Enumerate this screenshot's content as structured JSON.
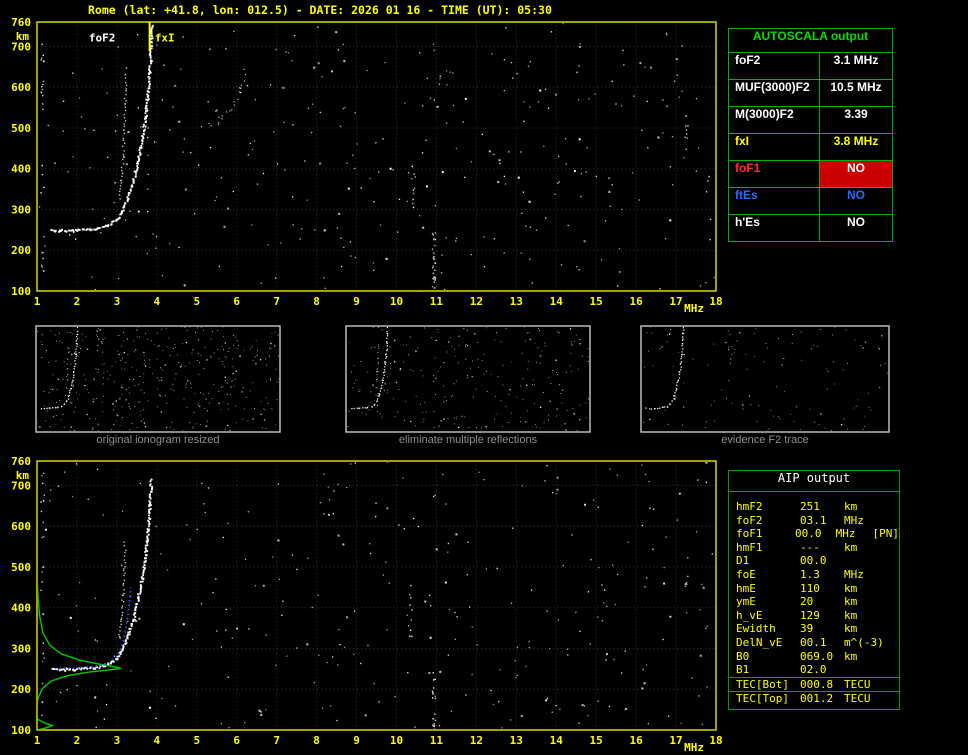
{
  "title": "Rome (lat: +41.8, lon: 012.5) - DATE: 2026 01 16 - TIME (UT): 05:30",
  "colors": {
    "axis": "#ffff00",
    "plot_border": "#e6e600",
    "table_green": "#00b400",
    "profile_green": "#00cc00",
    "fit_blue": "#3a5bff",
    "alert_red": "#cc0000",
    "es_blue": "#1e6eff",
    "caption_gray": "#8f8f8f"
  },
  "ionogram_top": {
    "y_unit": "km",
    "x_unit": "MHz",
    "y_ticks": [
      760,
      700,
      600,
      500,
      400,
      300,
      200,
      100
    ],
    "x_ticks": [
      1,
      2,
      3,
      4,
      5,
      6,
      7,
      8,
      9,
      10,
      11,
      12,
      13,
      14,
      15,
      16,
      17,
      18
    ],
    "f_range": [
      1,
      18
    ],
    "km_range": [
      100,
      760
    ],
    "annotations": [
      {
        "text": "foF2",
        "f": 2.3,
        "km": 712,
        "color": "#ffffff"
      },
      {
        "text": "fxI",
        "f": 3.95,
        "km": 712,
        "color": "#ffff00"
      }
    ],
    "marker_line": {
      "f": 3.82,
      "km_from": 688,
      "km_to": 760,
      "color": "#ffff00"
    },
    "traces": [
      {
        "points": [
          [
            1.35,
            250
          ],
          [
            1.9,
            250
          ],
          [
            2.45,
            255
          ],
          [
            2.75,
            262
          ],
          [
            2.95,
            274
          ],
          [
            3.1,
            295
          ],
          [
            3.25,
            330
          ],
          [
            3.4,
            375
          ],
          [
            3.52,
            425
          ],
          [
            3.62,
            475
          ],
          [
            3.7,
            530
          ],
          [
            3.76,
            590
          ],
          [
            3.81,
            655
          ],
          [
            3.84,
            715
          ],
          [
            3.86,
            752
          ]
        ],
        "size": 1.9,
        "step": 1.5,
        "jitter": 1.1,
        "color": "#ffffff"
      },
      {
        "points": [
          [
            3.05,
            330
          ],
          [
            3.1,
            375
          ],
          [
            3.14,
            430
          ],
          [
            3.17,
            495
          ],
          [
            3.19,
            560
          ],
          [
            3.21,
            630
          ]
        ],
        "size": 1.3,
        "step": 3,
        "jitter": 1,
        "color": "#d8d8d8"
      },
      {
        "points": [
          [
            5.15,
            505
          ],
          [
            5.5,
            515
          ],
          [
            5.85,
            545
          ],
          [
            6.1,
            595
          ],
          [
            6.2,
            645
          ]
        ],
        "size": 1.2,
        "step": 4.5,
        "jitter": 2.2,
        "color": "#c8c8c8"
      }
    ],
    "noise": {
      "count": 340,
      "seed": 20260116
    },
    "streaks": [
      {
        "f": 10.92,
        "km": [
          100,
          245
        ],
        "n": 26
      },
      {
        "f": 10.4,
        "km": [
          300,
          430
        ],
        "n": 10
      },
      {
        "f": 17.25,
        "km": [
          420,
          570
        ],
        "n": 8
      },
      {
        "f": 1.12,
        "km": [
          130,
          740
        ],
        "n": 24
      }
    ]
  },
  "ionogram_bottom": {
    "y_unit": "km",
    "x_unit": "MHz",
    "y_ticks": [
      760,
      700,
      600,
      500,
      400,
      300,
      200,
      100
    ],
    "x_ticks": [
      1,
      2,
      3,
      4,
      5,
      6,
      7,
      8,
      9,
      10,
      11,
      12,
      13,
      14,
      15,
      16,
      17,
      18
    ],
    "f_range": [
      1,
      18
    ],
    "km_range": [
      100,
      760
    ],
    "annotations": [],
    "traces": [
      {
        "points": [
          [
            1.35,
            250
          ],
          [
            1.9,
            250
          ],
          [
            2.45,
            255
          ],
          [
            2.75,
            262
          ],
          [
            2.95,
            274
          ],
          [
            3.1,
            295
          ],
          [
            3.25,
            330
          ],
          [
            3.4,
            375
          ],
          [
            3.52,
            425
          ],
          [
            3.62,
            475
          ],
          [
            3.7,
            530
          ],
          [
            3.76,
            590
          ],
          [
            3.81,
            655
          ],
          [
            3.84,
            715
          ]
        ],
        "size": 1.9,
        "step": 1.5,
        "jitter": 1.1,
        "color": "#ffffff"
      },
      {
        "points": [
          [
            3.05,
            330
          ],
          [
            3.1,
            375
          ],
          [
            3.14,
            430
          ],
          [
            3.17,
            495
          ],
          [
            3.19,
            560
          ]
        ],
        "size": 1.3,
        "step": 3,
        "jitter": 1,
        "color": "#d8d8d8"
      }
    ],
    "profile": {
      "color": "#00cc00",
      "points": [
        [
          1.02,
          100
        ],
        [
          1.3,
          107
        ],
        [
          1.38,
          111
        ],
        [
          1.2,
          117
        ],
        [
          1.02,
          126
        ],
        [
          0.97,
          140
        ],
        [
          0.98,
          158
        ],
        [
          1.03,
          178
        ],
        [
          1.12,
          200
        ],
        [
          1.35,
          220
        ],
        [
          1.75,
          233
        ],
        [
          2.3,
          242
        ],
        [
          2.85,
          248
        ],
        [
          3.1,
          251
        ],
        [
          2.95,
          255
        ],
        [
          2.55,
          262
        ],
        [
          2.05,
          272
        ],
        [
          1.6,
          287
        ],
        [
          1.32,
          308
        ],
        [
          1.15,
          338
        ],
        [
          1.07,
          378
        ],
        [
          1.03,
          420
        ],
        [
          1.01,
          455
        ]
      ]
    },
    "fit": {
      "color": "#3a5bff",
      "points": [
        [
          1.45,
          251
        ],
        [
          2.0,
          252
        ],
        [
          2.5,
          257
        ],
        [
          2.8,
          265
        ],
        [
          3.0,
          280
        ],
        [
          3.12,
          305
        ],
        [
          3.22,
          345
        ],
        [
          3.3,
          400
        ],
        [
          3.35,
          450
        ]
      ]
    },
    "noise": {
      "count": 300,
      "seed": 530
    },
    "streaks": [
      {
        "f": 10.92,
        "km": [
          100,
          255
        ],
        "n": 22
      },
      {
        "f": 10.35,
        "km": [
          330,
          470
        ],
        "n": 10
      },
      {
        "f": 1.12,
        "km": [
          140,
          740
        ],
        "n": 20
      },
      {
        "f": 17.25,
        "km": [
          430,
          560
        ],
        "n": 6
      }
    ]
  },
  "thumbnails": [
    {
      "caption": "original ionogram resized",
      "noise": {
        "count": 420,
        "seed": 5
      }
    },
    {
      "caption": "eliminate multiple reflections",
      "noise": {
        "count": 260,
        "seed": 9
      }
    },
    {
      "caption": "evidence F2 trace",
      "noise": {
        "count": 130,
        "seed": 13
      }
    }
  ],
  "autoscala": {
    "title": "AUTOSCALA output",
    "rows": [
      {
        "label": "foF2",
        "value": "3.1 MHz",
        "label_color": "#ffffff",
        "value_color": "#ffffff",
        "value_bg": ""
      },
      {
        "label": "MUF(3000)F2",
        "value": "10.5 MHz",
        "label_color": "#ffffff",
        "value_color": "#ffffff",
        "value_bg": ""
      },
      {
        "label": "M(3000)F2",
        "value": "3.39",
        "label_color": "#ffffff",
        "value_color": "#ffffff",
        "value_bg": ""
      },
      {
        "label": "fxI",
        "value": "3.8 MHz",
        "label_color": "#ffff00",
        "value_color": "#ffff00",
        "value_bg": ""
      },
      {
        "label": "foF1",
        "value": "NO",
        "label_color": "#ff3030",
        "value_color": "#ffffff",
        "value_bg": "#cc0000"
      },
      {
        "label": "ftEs",
        "value": "NO",
        "label_color": "#1e6eff",
        "value_color": "#1e6eff",
        "value_bg": ""
      },
      {
        "label": "h'Es",
        "value": "NO",
        "label_color": "#ffffff",
        "value_color": "#ffffff",
        "value_bg": ""
      }
    ]
  },
  "aip": {
    "title": "AIP output",
    "rows": [
      {
        "name": "hmF2",
        "value": "251",
        "unit": "km",
        "extra": "",
        "sep": false
      },
      {
        "name": "foF2",
        "value": "03.1",
        "unit": "MHz",
        "extra": "",
        "sep": false
      },
      {
        "name": "foF1",
        "value": "00.0",
        "unit": "MHz",
        "extra": "[PN]",
        "sep": false
      },
      {
        "name": "hmF1",
        "value": "---",
        "unit": "km",
        "extra": "",
        "sep": false
      },
      {
        "name": "D1",
        "value": "00.0",
        "unit": "",
        "extra": "",
        "sep": false
      },
      {
        "name": "foE",
        "value": "1.3",
        "unit": "MHz",
        "extra": "",
        "sep": false
      },
      {
        "name": "hmE",
        "value": "110",
        "unit": "km",
        "extra": "",
        "sep": false
      },
      {
        "name": "ymE",
        "value": "20",
        "unit": "km",
        "extra": "",
        "sep": false
      },
      {
        "name": "h_vE",
        "value": "129",
        "unit": "km",
        "extra": "",
        "sep": false
      },
      {
        "name": "Ewidth",
        "value": "39",
        "unit": "km",
        "extra": "",
        "sep": false
      },
      {
        "name": "DelN_vE",
        "value": "00.1",
        "unit": "m^(-3)",
        "extra": "",
        "sep": false
      },
      {
        "name": "B0",
        "value": "069.0",
        "unit": "km",
        "extra": "",
        "sep": false
      },
      {
        "name": "B1",
        "value": "02.0",
        "unit": "",
        "extra": "",
        "sep": false
      },
      {
        "name": "TEC[Bot]",
        "value": "000.8",
        "unit": "TECU",
        "extra": "",
        "sep": true
      },
      {
        "name": "TEC[Top]",
        "value": "001.2",
        "unit": "TECU",
        "extra": "",
        "sep": true
      }
    ]
  }
}
